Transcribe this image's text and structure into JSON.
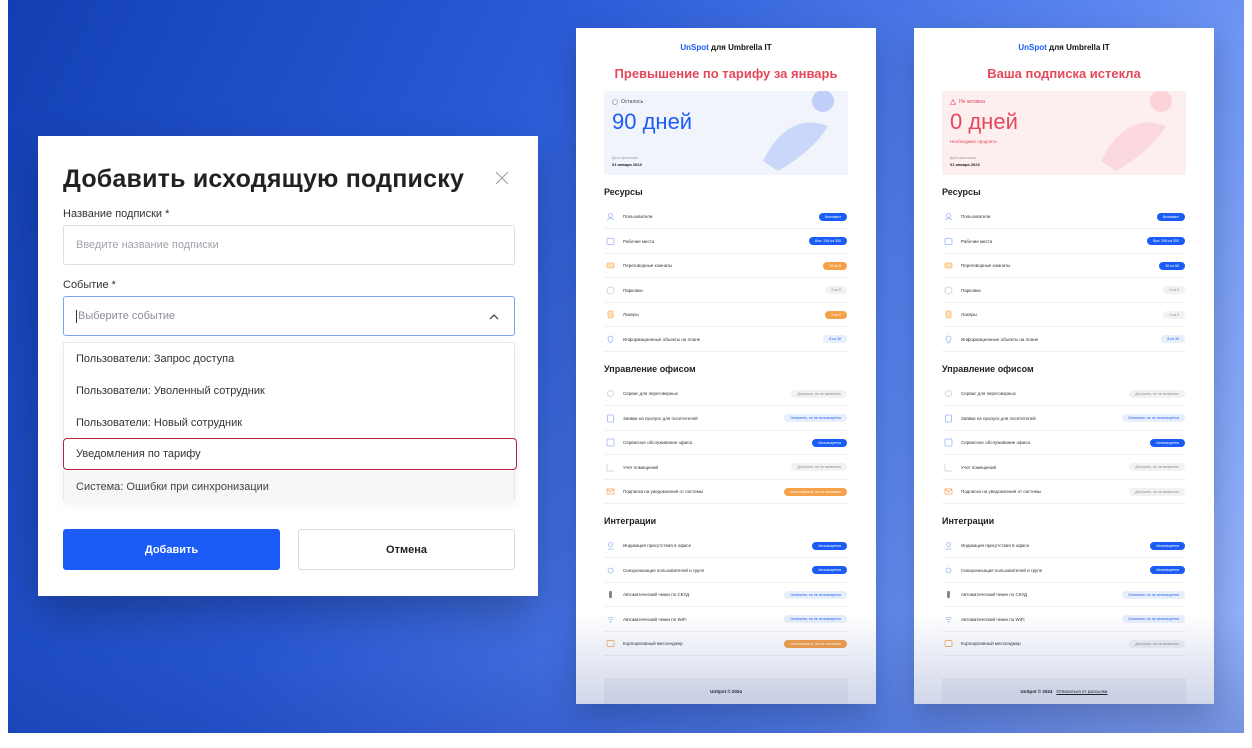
{
  "modal": {
    "title": "Добавить исходящую подписку",
    "name_label": "Название подписки *",
    "name_placeholder": "Введите название подписки",
    "event_label": "Событие *",
    "event_placeholder": "Выберите событие",
    "options": [
      {
        "label": "Пользователи: Запрос доступа",
        "state": "normal"
      },
      {
        "label": "Пользователи: Уволенный сотрудник",
        "state": "normal"
      },
      {
        "label": "Пользователи: Новый сотрудник",
        "state": "normal"
      },
      {
        "label": "Уведомления по тарифу",
        "state": "selected"
      },
      {
        "label": "Система: Ошибки при синхронизации",
        "state": "disabled"
      }
    ],
    "add_label": "Добавить",
    "cancel_label": "Отмена"
  },
  "emails": [
    {
      "brand_accent": "UnSpot",
      "brand_rest": " для Umbrella IT",
      "heading": "Превышение по тарифу за январь",
      "hero": {
        "status": "Осталось",
        "big": "90 дней",
        "sub": "",
        "date_label": "Дата окончания",
        "date": "01 января 2023"
      },
      "sections": [
        {
          "title": "Ресурсы",
          "rows": [
            {
              "icon": "users-icon",
              "label": "Пользователи",
              "badge": "Безлимит",
              "style": "blue"
            },
            {
              "icon": "workplace-icon",
              "label": "Рабочие места",
              "badge": "Все: 246 из 300",
              "style": "blue"
            },
            {
              "icon": "meeting-room-icon",
              "label": "Переговорные комнаты",
              "badge": "10 из 6",
              "style": "orange"
            },
            {
              "icon": "parking-icon",
              "label": "Парковки",
              "badge": "0 из 0",
              "style": "gray"
            },
            {
              "icon": "locker-icon",
              "label": "Локеры",
              "badge": "2 из 0",
              "style": "orange"
            },
            {
              "icon": "info-pin-icon",
              "label": "Информационные объекты на плане",
              "badge": "8 из 30",
              "style": "lightblue"
            }
          ]
        },
        {
          "title": "Управление офисом",
          "rows": [
            {
              "icon": "meeting-service-icon",
              "label": "Сервис для переговорных",
              "badge": "Доступно, но не включено",
              "style": "gray"
            },
            {
              "icon": "pass-icon",
              "label": "Заявки на пропуск для посетителей",
              "badge": "Оплачено, но не используется",
              "style": "lightblue"
            },
            {
              "icon": "service-icon",
              "label": "Сервисное обслуживание офиса",
              "badge": "Используется",
              "style": "blue"
            },
            {
              "icon": "rooms-icon",
              "label": "Учет помещений",
              "badge": "Доступно, но не включено",
              "style": "gray"
            },
            {
              "icon": "mail-icon",
              "label": "Подписка на уведомления от системы",
              "badge": "Используется, но не оплачено",
              "style": "orange"
            }
          ]
        },
        {
          "title": "Интеграции",
          "rows": [
            {
              "icon": "presence-icon",
              "label": "Индикация присутствия в офисе",
              "badge": "Используется",
              "style": "blue"
            },
            {
              "icon": "sync-icon",
              "label": "Синхронизация пользователей и групп",
              "badge": "Используется",
              "style": "blue"
            },
            {
              "icon": "access-control-icon",
              "label": "Автоматический чекин по СКУД",
              "badge": "Оплачено, но не используется",
              "style": "lightblue"
            },
            {
              "icon": "wifi-icon",
              "label": "Автоматический чекин по WiFi",
              "badge": "Оплачено, но не используется",
              "style": "lightblue"
            },
            {
              "icon": "messenger-icon",
              "label": "Корпоративный мессенджер",
              "badge": "Используется, но не оплачено",
              "style": "orange"
            }
          ]
        }
      ],
      "footer": "UnSpot © 2024",
      "footer_link": ""
    },
    {
      "brand_accent": "UnSpot",
      "brand_rest": " для Umbrella IT",
      "heading": "Ваша подписка истекла",
      "hero": {
        "status": "Не активна",
        "big": "0 дней",
        "sub": "Необходимо продлить",
        "date_label": "Дата окончания",
        "date": "01 января 2023"
      },
      "sections": [
        {
          "title": "Ресурсы",
          "rows": [
            {
              "icon": "users-icon",
              "label": "Пользователи",
              "badge": "Безлимит",
              "style": "blue"
            },
            {
              "icon": "workplace-icon",
              "label": "Рабочие места",
              "badge": "Все: 246 из 300",
              "style": "blue"
            },
            {
              "icon": "meeting-room-icon",
              "label": "Переговорные комнаты",
              "badge": "30 из 66",
              "style": "blue"
            },
            {
              "icon": "parking-icon",
              "label": "Парковки",
              "badge": "0 из 0",
              "style": "gray"
            },
            {
              "icon": "locker-icon",
              "label": "Локеры",
              "badge": "0 из 0",
              "style": "gray"
            },
            {
              "icon": "info-pin-icon",
              "label": "Информационные объекты на плане",
              "badge": "8 из 30",
              "style": "lightblue"
            }
          ]
        },
        {
          "title": "Управление офисом",
          "rows": [
            {
              "icon": "meeting-service-icon",
              "label": "Сервис для переговорных",
              "badge": "Доступно, но не включено",
              "style": "gray"
            },
            {
              "icon": "pass-icon",
              "label": "Заявки на пропуск для посетителей",
              "badge": "Оплачено, но не используется",
              "style": "lightblue"
            },
            {
              "icon": "service-icon",
              "label": "Сервисное обслуживание офиса",
              "badge": "Используется",
              "style": "blue"
            },
            {
              "icon": "rooms-icon",
              "label": "Учет помещений",
              "badge": "Доступно, но не включено",
              "style": "gray"
            },
            {
              "icon": "mail-icon",
              "label": "Подписка на уведомления от системы",
              "badge": "Доступно, но не включено",
              "style": "gray"
            }
          ]
        },
        {
          "title": "Интеграции",
          "rows": [
            {
              "icon": "presence-icon",
              "label": "Индикация присутствия в офисе",
              "badge": "Используется",
              "style": "blue"
            },
            {
              "icon": "sync-icon",
              "label": "Синхронизация пользователей и групп",
              "badge": "Используется",
              "style": "blue"
            },
            {
              "icon": "access-control-icon",
              "label": "Автоматический чекин по СКУД",
              "badge": "Оплачено, но не используется",
              "style": "lightblue"
            },
            {
              "icon": "wifi-icon",
              "label": "Автоматический чекин по WiFi",
              "badge": "Оплачено, но не используется",
              "style": "lightblue"
            },
            {
              "icon": "messenger-icon",
              "label": "Корпоративный мессенджер",
              "badge": "Доступно, но не включено",
              "style": "gray"
            }
          ]
        }
      ],
      "footer": "UnSpot © 2024",
      "footer_link": "Отписаться от рассылки"
    }
  ],
  "colors": {
    "primary": "#1a5cf5",
    "danger": "#e5485b",
    "selected_outline": "#b4263c",
    "warning": "#f5a14a"
  }
}
